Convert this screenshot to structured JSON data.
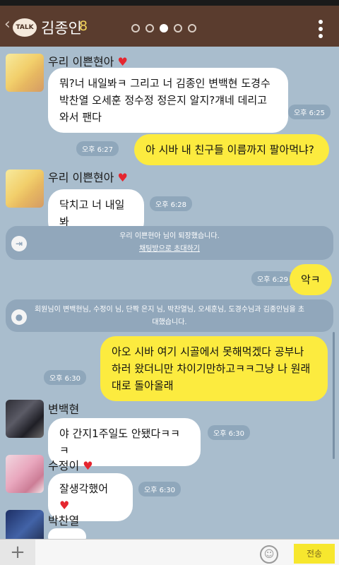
{
  "header": {
    "back_icon": "chevron-left-icon",
    "talk_logo": "TALK",
    "title": "김종인",
    "member_count": "8",
    "menu_icon": "more-vertical-icon"
  },
  "messages": [
    {
      "sender": "우리 이쁜현아",
      "text": "뭐?너 내일봐ㅋ 그리고 너 김종인 변백현 도경수 박찬열 오세훈 정수정 정은지 알지?걔네 데리고 와서 팬다",
      "time": "오후 6:25"
    },
    {
      "sender": "me",
      "text": "아 시바 내 친구들 이름까지 팔아먹냐?",
      "time": "오후 6:27"
    },
    {
      "sender": "우리 이쁜현아",
      "text": "닥치고 너 내일봐",
      "time": "오후 6:28"
    },
    {
      "sender": "me",
      "text": "악ㅋ",
      "time": "오후 6:29"
    },
    {
      "sender": "me",
      "text": "아오 시바 여기 시골에서 못해먹겠다 공부나 하러 왔더니만 차이기만하고ㅋㅋ그냥 나 원래대로 돌아올래",
      "time": "오후 6:30"
    },
    {
      "sender": "변백현",
      "text": "야 간지1주일도 안됐다ㅋㅋㅋ",
      "time": "오후 6:30"
    },
    {
      "sender": "수정이",
      "text": "잘생각했어",
      "time": "오후 6:30"
    },
    {
      "sender": "박찬열",
      "text": "",
      "time": ""
    }
  ],
  "notices": [
    {
      "text": "우리 이쁜현아 님이 퇴장했습니다.",
      "link": "채팅방으로 초대하기"
    },
    {
      "text": "회원님이 변백현님, 수정이 님, 단짝 은지 님, 박찬열님, 오세훈님, 도경수님과 김종인님을 초대했습니다."
    }
  ],
  "input": {
    "plus_label": "+",
    "placeholder": "",
    "emoji_icon": "smile-icon",
    "send_label": "전송"
  },
  "colors": {
    "header_bg": "#5a3c2e",
    "chat_bg": "#a9bdcd",
    "my_bubble": "#fceb3f",
    "other_bubble": "#ffffff",
    "time_badge": "#8fa7bb"
  }
}
